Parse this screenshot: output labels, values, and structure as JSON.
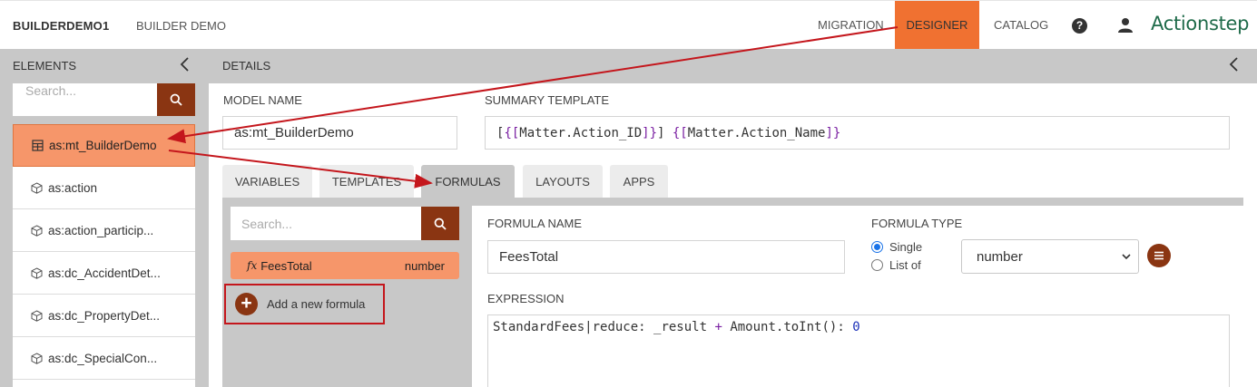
{
  "header": {
    "brand": "BUILDERDEMO1",
    "subtitle": "BUILDER DEMO",
    "nav": {
      "migration": "MIGRATION",
      "designer": "DESIGNER",
      "catalog": "CATALOG"
    },
    "help_icon": "?",
    "logo": "Actionstep",
    "accent_color": "#f07131"
  },
  "elements_panel": {
    "title": "ELEMENTS",
    "search_placeholder": "Search...",
    "items": [
      {
        "label": "as:mt_BuilderDemo",
        "icon": "table-icon",
        "active": true
      },
      {
        "label": "as:action",
        "icon": "cube-icon"
      },
      {
        "label": "as:action_particip...",
        "icon": "cube-icon"
      },
      {
        "label": "as:dc_AccidentDet...",
        "icon": "cube-icon"
      },
      {
        "label": "as:dc_PropertyDet...",
        "icon": "cube-icon"
      },
      {
        "label": "as:dc_SpecialCon...",
        "icon": "cube-icon"
      }
    ]
  },
  "details": {
    "title": "DETAILS",
    "model_name_label": "MODEL NAME",
    "model_name_value": "as:mt_BuilderDemo",
    "summary_label": "SUMMARY TEMPLATE",
    "summary_parts": {
      "p1": "[",
      "p2": "{[",
      "p3": "Matter.Action_ID",
      "p4": "]}",
      "p5": "] ",
      "p6": "{[",
      "p7": "Matter.Action_Name",
      "p8": "]}"
    },
    "tabs": [
      "VARIABLES",
      "TEMPLATES",
      "FORMULAS",
      "LAYOUTS",
      "APPS"
    ],
    "active_tab": "FORMULAS"
  },
  "formulas": {
    "search_placeholder": "Search...",
    "items": [
      {
        "fx": "fx",
        "name": "FeesTotal",
        "type": "number"
      }
    ],
    "add_label": "Add a new formula",
    "editor": {
      "name_label": "FORMULA NAME",
      "name_value": "FeesTotal",
      "type_label": "FORMULA TYPE",
      "radio_single": "Single",
      "radio_list": "List of",
      "selected_radio": "Single",
      "type_value": "number",
      "expression_label": "EXPRESSION",
      "expression_parts": {
        "a": "StandardFees",
        "b": "|",
        "c": "reduce: _result ",
        "d": "+",
        "e": " Amount.toInt(): ",
        "f": "0"
      }
    }
  },
  "colors": {
    "brown": "#8a3512",
    "orange_light": "#f6966a",
    "annotation_red": "#c4161c"
  }
}
